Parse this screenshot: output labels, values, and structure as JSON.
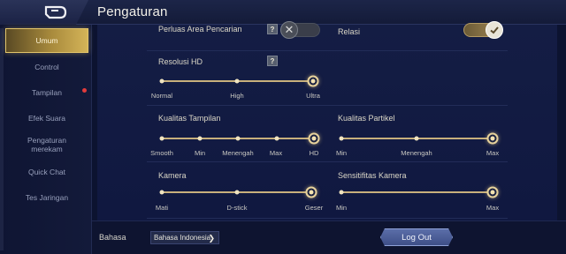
{
  "header": {
    "title": "Pengaturan"
  },
  "sidebar": {
    "items": [
      {
        "label": "Umum",
        "active": true
      },
      {
        "label": "Control"
      },
      {
        "label": "Tampilan",
        "notification": true
      },
      {
        "label": "Efek Suara"
      },
      {
        "label": "Pengaturan merekam"
      },
      {
        "label": "Quick Chat"
      },
      {
        "label": "Tes Jaringan"
      }
    ]
  },
  "settings": {
    "perluas": {
      "label": "Perluas Area Pencarian",
      "help": "?",
      "enabled": false
    },
    "relasi": {
      "label": "Relasi",
      "enabled": true
    },
    "resolusi": {
      "label": "Resolusi HD",
      "help": "?",
      "options": [
        "Normal",
        "High",
        "Ultra"
      ],
      "selected": "Ultra"
    },
    "kualitas_tampilan": {
      "label": "Kualitas Tampilan",
      "options": [
        "Smooth",
        "Min",
        "Menengah",
        "Max",
        "HD"
      ],
      "selected": "HD"
    },
    "kualitas_partikel": {
      "label": "Kualitas Partikel",
      "options": [
        "Min",
        "Menengah",
        "Max"
      ],
      "selected": "Max"
    },
    "kamera": {
      "label": "Kamera",
      "options": [
        "Mati",
        "D-stick",
        "Geser"
      ],
      "selected": "Geser"
    },
    "sensitifitas": {
      "label": "Sensitifitas Kamera",
      "min_label": "Min",
      "max_label": "Max",
      "value_fraction": 1.0
    }
  },
  "footer": {
    "language_label": "Bahasa",
    "language_value": "Bahasa Indonesia",
    "logout_label": "Log Out"
  },
  "colors": {
    "accent_gold": "#e7d29c",
    "background": "#0c1330",
    "button_blue": "#4f61a0"
  }
}
